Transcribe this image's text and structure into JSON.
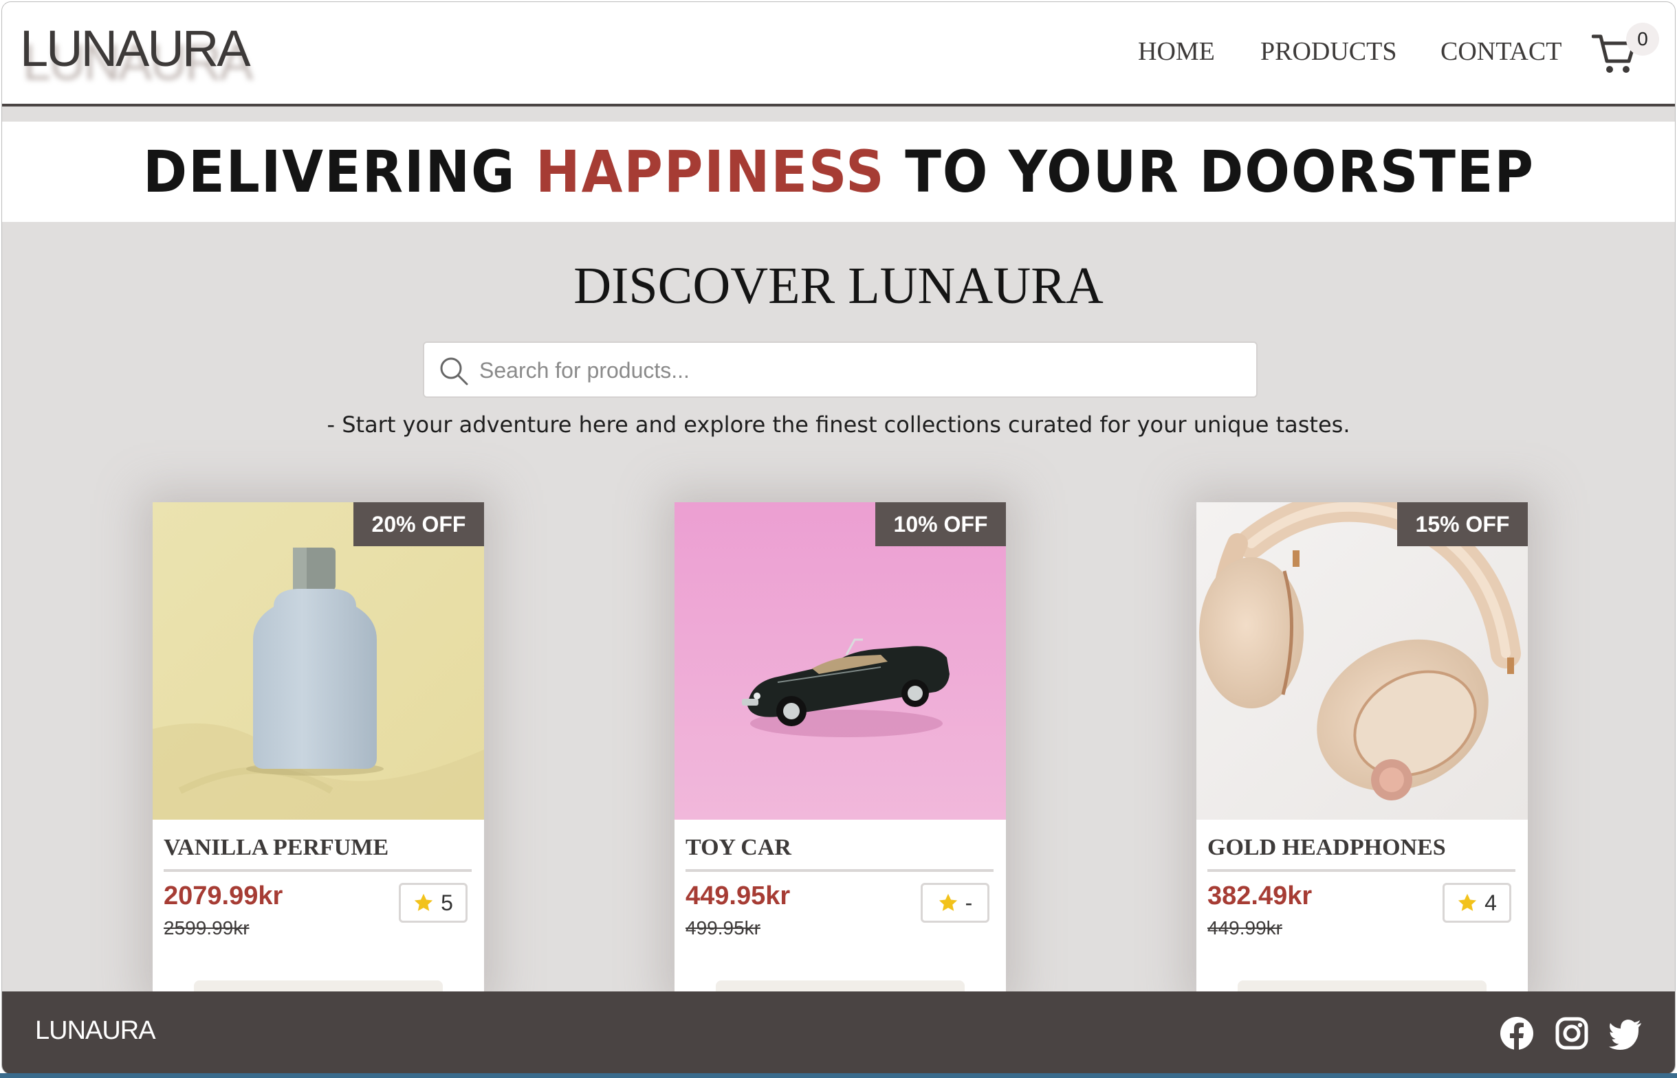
{
  "brand": {
    "logo": "LUNAURA"
  },
  "nav": {
    "home": "HOME",
    "products": "PRODUCTS",
    "contact": "CONTACT",
    "cart_icon": "cart-icon",
    "cart_count": "0"
  },
  "banner": {
    "part1": "DELIVERING ",
    "highlight": "HAPPINESS",
    "part2": " TO YOUR DOORSTEP"
  },
  "discover": {
    "title": "DISCOVER LUNAURA",
    "search_placeholder": "Search for products...",
    "tagline": "- Start your adventure here and explore the finest collections curated for your unique tastes."
  },
  "products": [
    {
      "name": "VANILLA PERFUME",
      "discount": "20% OFF",
      "price": "2079.99kr",
      "old_price": "2599.99kr",
      "rating": "5"
    },
    {
      "name": "TOY CAR",
      "discount": "10% OFF",
      "price": "449.95kr",
      "old_price": "499.95kr",
      "rating": "-"
    },
    {
      "name": "GOLD HEADPHONES",
      "discount": "15% OFF",
      "price": "382.49kr",
      "old_price": "449.99kr",
      "rating": "4"
    }
  ],
  "footer": {
    "logo": "LUNAURA",
    "icons": [
      "facebook-icon",
      "instagram-icon",
      "twitter-icon"
    ]
  },
  "colors": {
    "accent": "#a63c34",
    "dark": "#4a4443",
    "background": "#e0dedd",
    "badge": "#5b5351",
    "star": "#f2c21b"
  }
}
